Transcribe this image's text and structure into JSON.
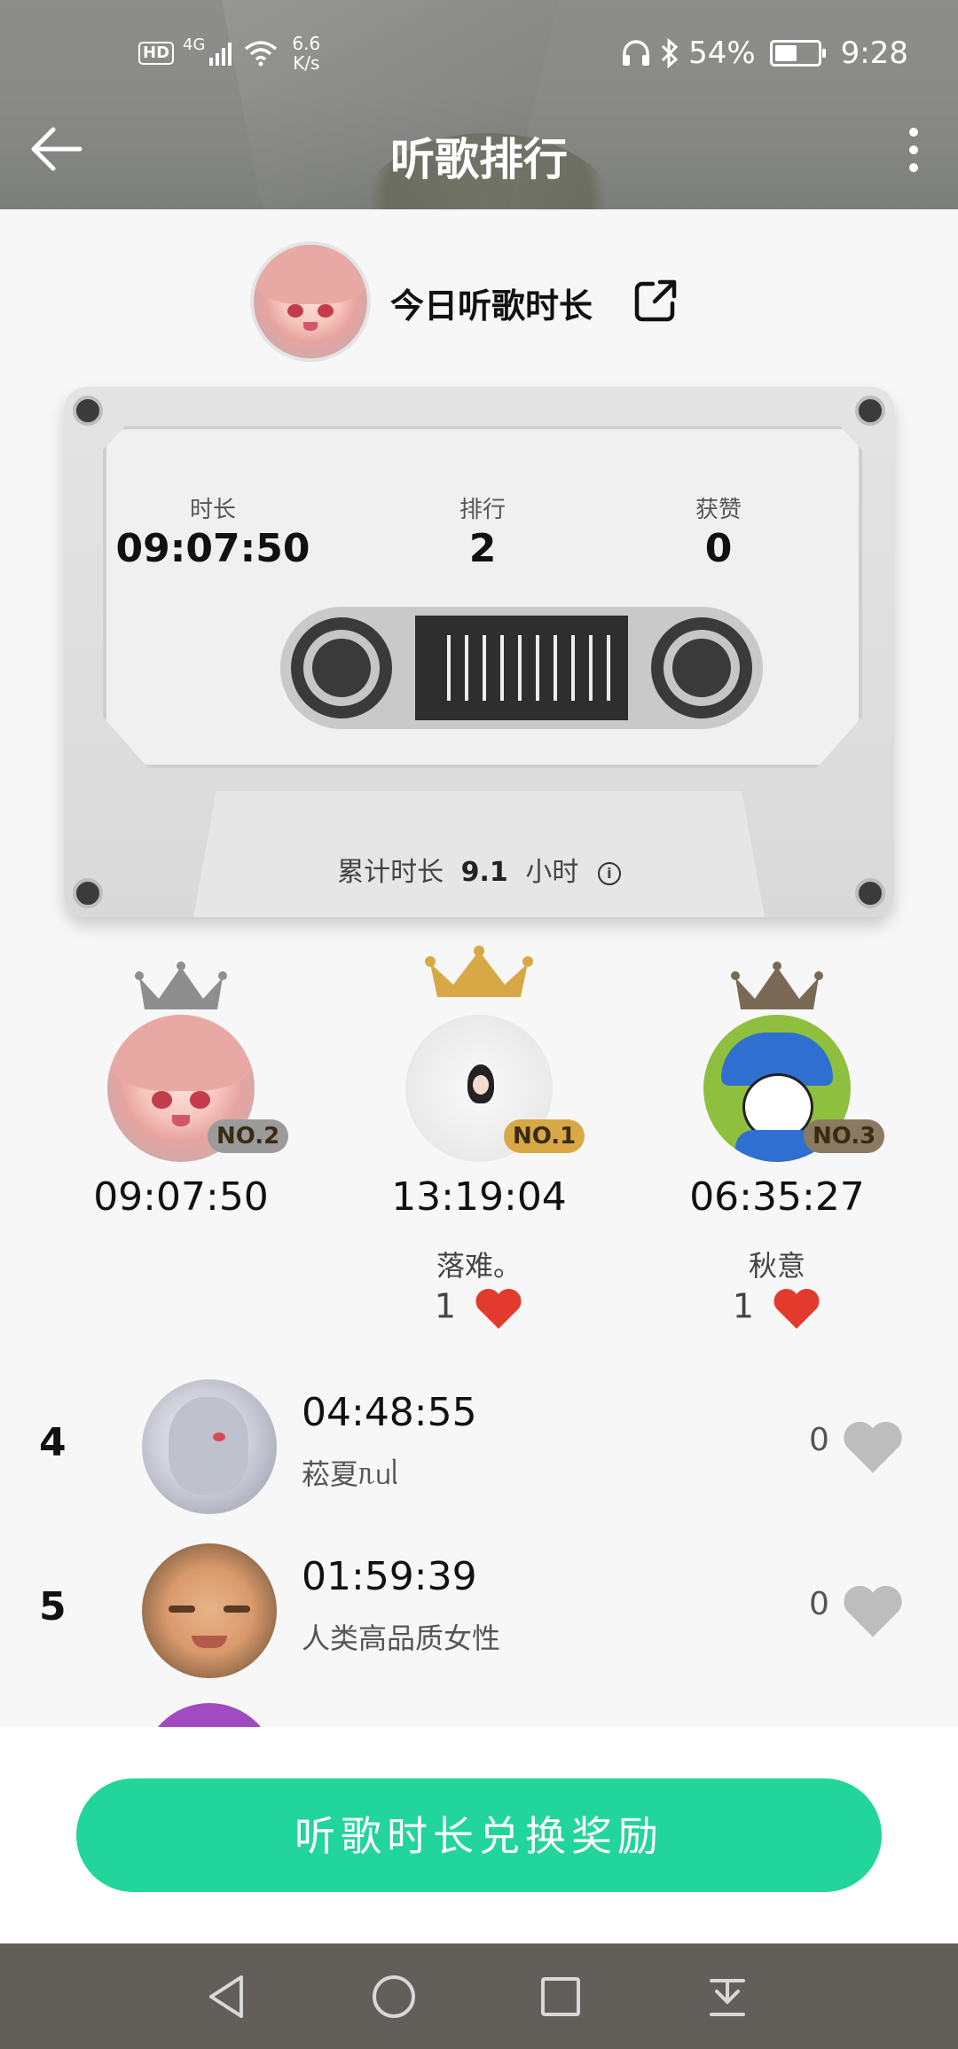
{
  "status_bar": {
    "hd": "HD",
    "signal": "4G",
    "speed_value": "6.6",
    "speed_unit": "K/s",
    "battery": "54%",
    "time": "9:28"
  },
  "header": {
    "title": "听歌排行"
  },
  "today": {
    "label": "今日听歌时长"
  },
  "cassette": {
    "stats": [
      {
        "label": "时长",
        "value": "09:07:50"
      },
      {
        "label": "排行",
        "value": "2"
      },
      {
        "label": "获赞",
        "value": "0"
      }
    ],
    "total_prefix": "累计时长",
    "total_value": "9.1",
    "total_unit": "小时"
  },
  "podium": {
    "first": {
      "badge": "NO.1",
      "time": "13:19:04",
      "name": "落难。",
      "likes": "1",
      "crown_color": "#d7a845"
    },
    "second": {
      "badge": "NO.2",
      "time": "09:07:50",
      "name": "",
      "likes": "",
      "crown_color": "#8e8e8e"
    },
    "third": {
      "badge": "NO.3",
      "time": "06:35:27",
      "name": "秋意",
      "likes": "1",
      "crown_color": "#7a6a55"
    }
  },
  "list": [
    {
      "rank": "4",
      "time": "04:48:55",
      "name": "菘夏ᥰᥙᥣ",
      "likes": "0"
    },
    {
      "rank": "5",
      "time": "01:59:39",
      "name": "人类高品质女性",
      "likes": "0"
    }
  ],
  "cta": {
    "label": "听歌时长兑换奖励"
  },
  "colors": {
    "accent": "#22d59a",
    "heart_red": "#e23b2e",
    "heart_gray": "#bdbdbd"
  }
}
